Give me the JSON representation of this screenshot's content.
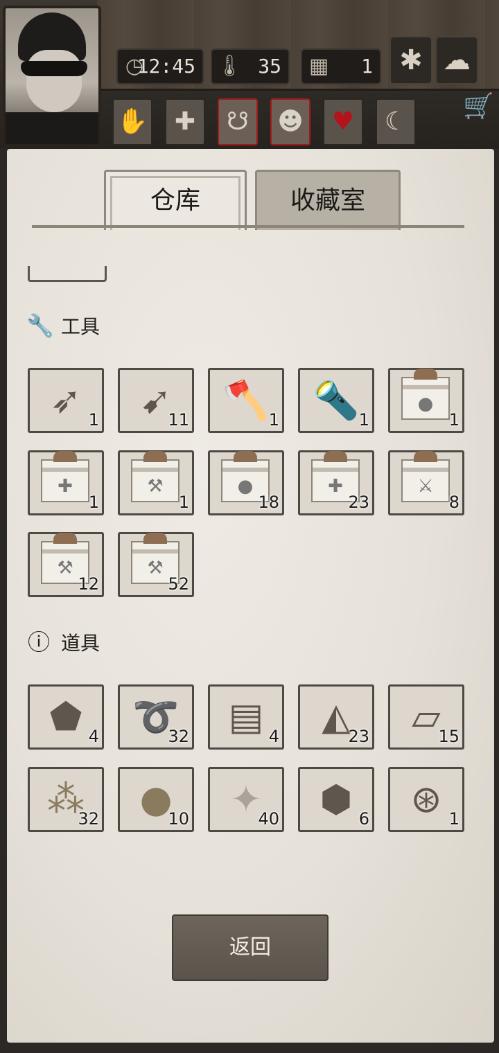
{
  "header": {
    "time": "12:45",
    "temperature": "35",
    "day": "1",
    "icons": {
      "clock": "clock-icon",
      "thermometer": "thermometer-icon",
      "calendar": "calendar-icon",
      "season": "leaf-icon",
      "weather": "cloud-icon",
      "shop": "cart-icon"
    }
  },
  "status_buttons": [
    {
      "name": "bandage-hand-icon",
      "alert": false
    },
    {
      "name": "medical-cross-icon",
      "alert": false
    },
    {
      "name": "stomach-icon",
      "alert": true
    },
    {
      "name": "head-icon",
      "alert": true
    },
    {
      "name": "heart-icon",
      "alert": false
    },
    {
      "name": "moon-icon",
      "alert": false
    }
  ],
  "tabs": [
    {
      "label": "仓库",
      "active": true
    },
    {
      "label": "收藏室",
      "active": false
    }
  ],
  "sections": {
    "tools": {
      "title": "工具",
      "items": [
        {
          "icon": "bow-icon",
          "count": "1"
        },
        {
          "icon": "arrows-icon",
          "count": "11"
        },
        {
          "icon": "axe-icon",
          "count": "1"
        },
        {
          "icon": "flashlight-icon",
          "count": "1"
        },
        {
          "icon": "gift-box-food-icon",
          "count": "1"
        },
        {
          "icon": "gift-box-medical-icon",
          "count": "1"
        },
        {
          "icon": "gift-box-tools-wood-icon",
          "count": "1"
        },
        {
          "icon": "gift-box-food-icon",
          "count": "18"
        },
        {
          "icon": "gift-box-medical-icon",
          "count": "23"
        },
        {
          "icon": "gift-box-weapons-icon",
          "count": "8"
        },
        {
          "icon": "gift-box-hammer-icon",
          "count": "12"
        },
        {
          "icon": "gift-box-tools-wood-icon",
          "count": "52"
        }
      ]
    },
    "props": {
      "title": "道具",
      "items": [
        {
          "icon": "stone-icon",
          "count": "4"
        },
        {
          "icon": "rope-icon",
          "count": "32"
        },
        {
          "icon": "planks-icon",
          "count": "4"
        },
        {
          "icon": "flint-icon",
          "count": "23"
        },
        {
          "icon": "bone-fragments-icon",
          "count": "15"
        },
        {
          "icon": "gold-nuggets-icon",
          "count": "32"
        },
        {
          "icon": "ore-icon",
          "count": "10"
        },
        {
          "icon": "crystal-icon",
          "count": "40"
        },
        {
          "icon": "cube-box-icon",
          "count": "6"
        },
        {
          "icon": "compass-icon",
          "count": "1"
        }
      ]
    }
  },
  "footer": {
    "back_label": "返回"
  }
}
